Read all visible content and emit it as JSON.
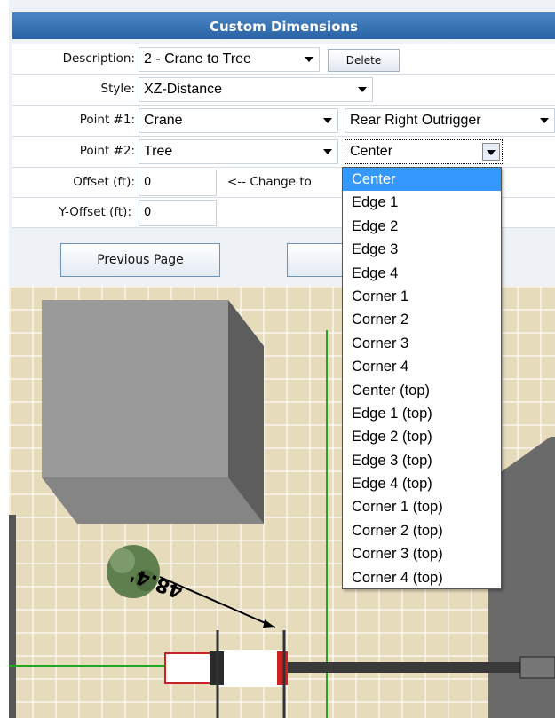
{
  "header": {
    "title": "Custom Dimensions"
  },
  "form": {
    "description": {
      "label": "Description:",
      "value": "2 - Crane to Tree",
      "delete_label": "Delete"
    },
    "style": {
      "label": "Style:",
      "value": "XZ-Distance"
    },
    "point1": {
      "label": "Point #1:",
      "object": "Crane",
      "location": "Rear Right Outrigger"
    },
    "point2": {
      "label": "Point #2:",
      "object": "Tree",
      "location": "Center"
    },
    "offset": {
      "label": "Offset (ft):",
      "value": "0",
      "hint": "<-- Change to"
    },
    "y_offset": {
      "label": "Y-Offset (ft):",
      "value": "0"
    }
  },
  "nav": {
    "previous_label": "Previous Page"
  },
  "dropdown": {
    "selected": "Center",
    "options": [
      "Center",
      "Edge 1",
      "Edge 2",
      "Edge 3",
      "Edge 4",
      "Corner 1",
      "Corner 2",
      "Corner 3",
      "Corner 4",
      "Center (top)",
      "Edge 1 (top)",
      "Edge 2 (top)",
      "Edge 3 (top)",
      "Edge 4 (top)",
      "Corner 1 (top)",
      "Corner 2 (top)",
      "Corner 3 (top)",
      "Corner 4 (top)"
    ]
  },
  "scene": {
    "dimension_label": "48.4'"
  },
  "colors": {
    "header": "#2f6fb3",
    "highlight": "#3399ff",
    "ground": "#e6dcbc",
    "guide": "#21a821"
  }
}
